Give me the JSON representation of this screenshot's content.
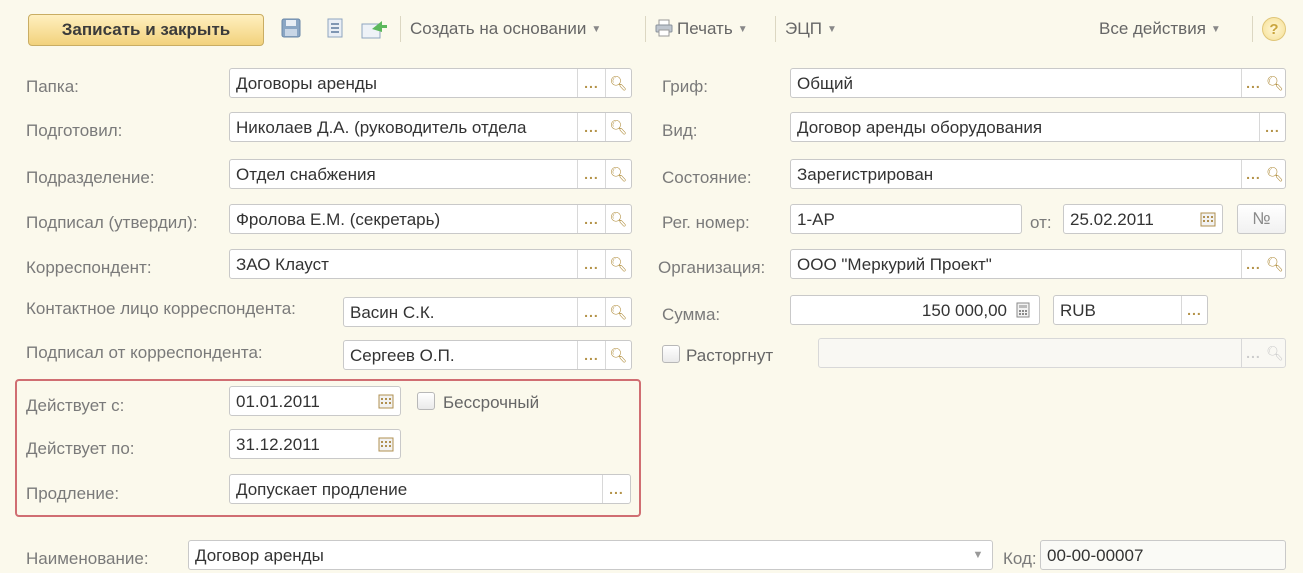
{
  "toolbar": {
    "save_close": "Записать и закрыть",
    "create_based": "Создать на основании",
    "print": "Печать",
    "eds": "ЭЦП",
    "all_actions": "Все действия",
    "help": "?"
  },
  "left": {
    "folder_label": "Папка:",
    "folder_value": "Договоры аренды",
    "prepared_label": "Подготовил:",
    "prepared_value": "Николаев Д.А. (руководитель отдела",
    "department_label": "Подразделение:",
    "department_value": "Отдел снабжения",
    "signed_label": "Подписал (утвердил):",
    "signed_value": "Фролова Е.М. (секретарь)",
    "correspondent_label": "Корреспондент:",
    "correspondent_value": "ЗАО Клауст",
    "contact_label": "Контактное лицо корреспондента:",
    "contact_value": "Васин С.К.",
    "signed_corr_label": "Подписал от корреспондента:",
    "signed_corr_value": "Сергеев О.П."
  },
  "right": {
    "grif_label": "Гриф:",
    "grif_value": "Общий",
    "kind_label": "Вид:",
    "kind_value": "Договор аренды оборудования",
    "state_label": "Состояние:",
    "state_value": "Зарегистрирован",
    "regnum_label": "Рег. номер:",
    "regnum_value": "1-АР",
    "from_label": "от:",
    "from_value": "25.02.2011",
    "num_button": "№",
    "org_label": "Организация:",
    "org_value": "ООО \"Меркурий Проект\"",
    "sum_label": "Сумма:",
    "sum_value": "150 000,00",
    "currency_value": "RUB",
    "terminated_label": "Расторгнут",
    "terminated_checked": false
  },
  "validity": {
    "from_label": "Действует с:",
    "from_value": "01.01.2011",
    "perpetual_label": "Бессрочный",
    "perpetual_checked": false,
    "to_label": "Действует по:",
    "to_value": "31.12.2011",
    "extension_label": "Продление:",
    "extension_value": "Допускает продление"
  },
  "bottom": {
    "name_label": "Наименование:",
    "name_value": "Договор аренды",
    "code_label": "Код:",
    "code_value": "00-00-00007"
  },
  "colors": {
    "background": "#fbf9ec",
    "primary_button": "#f2d27c",
    "highlight_border": "#d06e72"
  }
}
